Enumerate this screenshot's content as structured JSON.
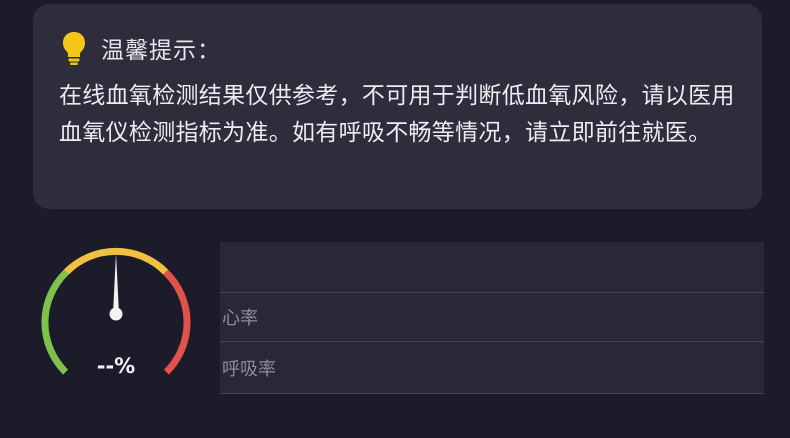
{
  "tip": {
    "title": "温馨提示：",
    "icon": "lightbulb-icon",
    "body": "在线血氧检测结果仅供参考，不可用于判断低血氧风险，请以医用血氧仪检测指标为准。如有呼吸不畅等情况，请立即前往就医。"
  },
  "gauge": {
    "value_text": "--%",
    "colors": {
      "low": "#7dc24b",
      "mid": "#f0c040",
      "high": "#e0524a",
      "needle": "#f2f2f2"
    }
  },
  "metrics": [
    {
      "label": ""
    },
    {
      "label": "心率"
    },
    {
      "label": "呼吸率"
    }
  ],
  "colors": {
    "background": "#1c1b29",
    "card": "#2e2d3b",
    "bulb": "#f5c518"
  }
}
